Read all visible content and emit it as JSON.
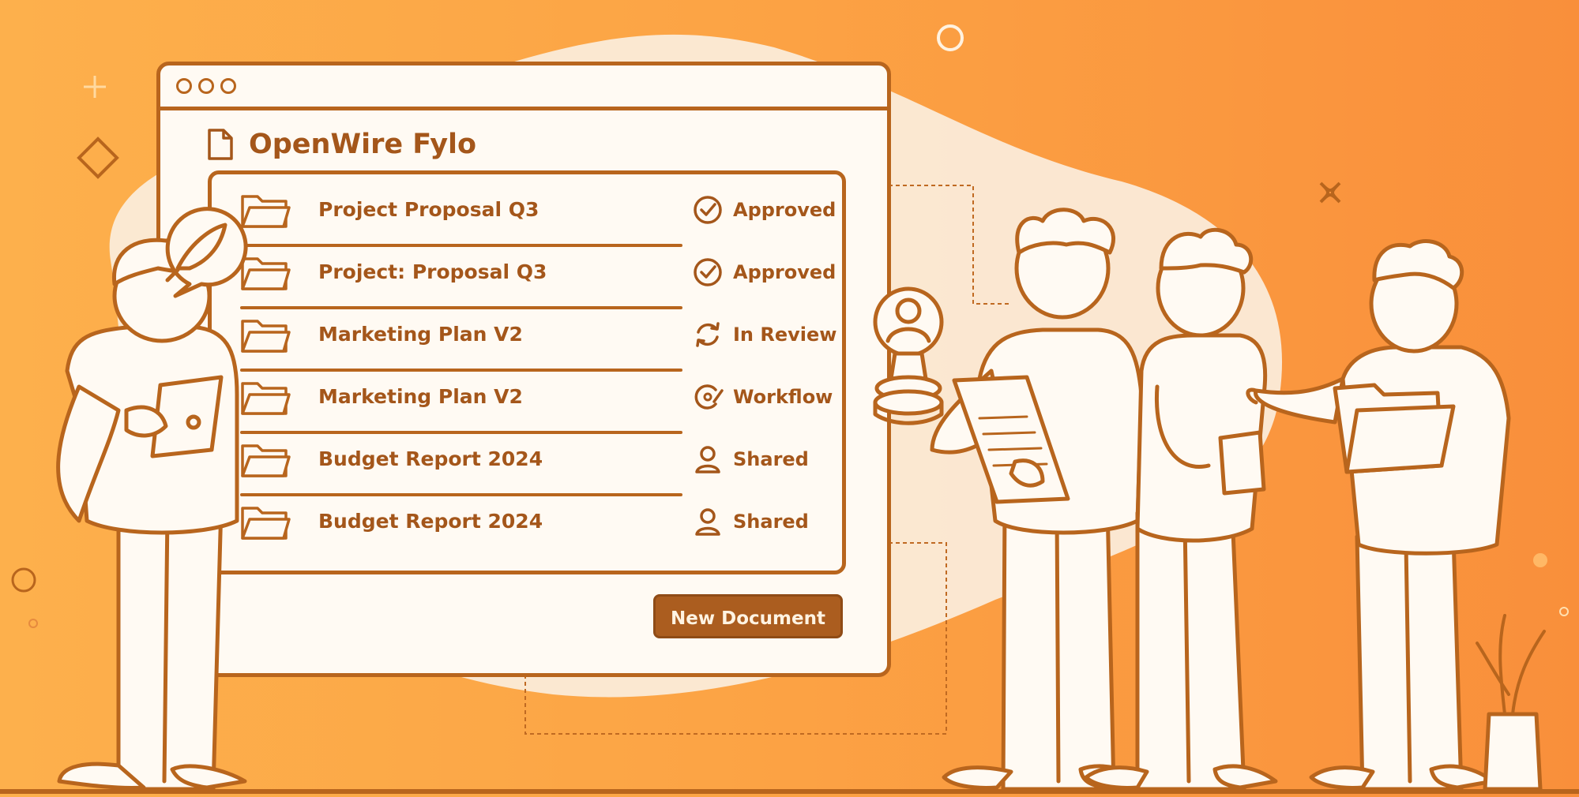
{
  "app": {
    "title": "OpenWire Fylo",
    "title_icon": "document-icon"
  },
  "files": [
    {
      "name": "Project Proposal Q3",
      "status": "Approved",
      "icon": "check-circle-icon"
    },
    {
      "name": "Project: Proposal Q3",
      "status": "Approved",
      "icon": "check-circle-icon"
    },
    {
      "name": "Marketing Plan V2",
      "status": "In Review",
      "icon": "refresh-icon"
    },
    {
      "name": "Marketing Plan V2",
      "status": "Workflow",
      "icon": "workflow-icon"
    },
    {
      "name": "Budget Report 2024",
      "status": "Shared",
      "icon": "user-icon"
    },
    {
      "name": "Budget Report 2024",
      "status": "Shared",
      "icon": "user-icon"
    }
  ],
  "actions": {
    "new_document": "New Document"
  },
  "colors": {
    "background_start": "#fdb04c",
    "background_end": "#f98f3b",
    "ink": "#b8651d",
    "button": "#ab5d1f",
    "paper": "#fffaf3"
  }
}
